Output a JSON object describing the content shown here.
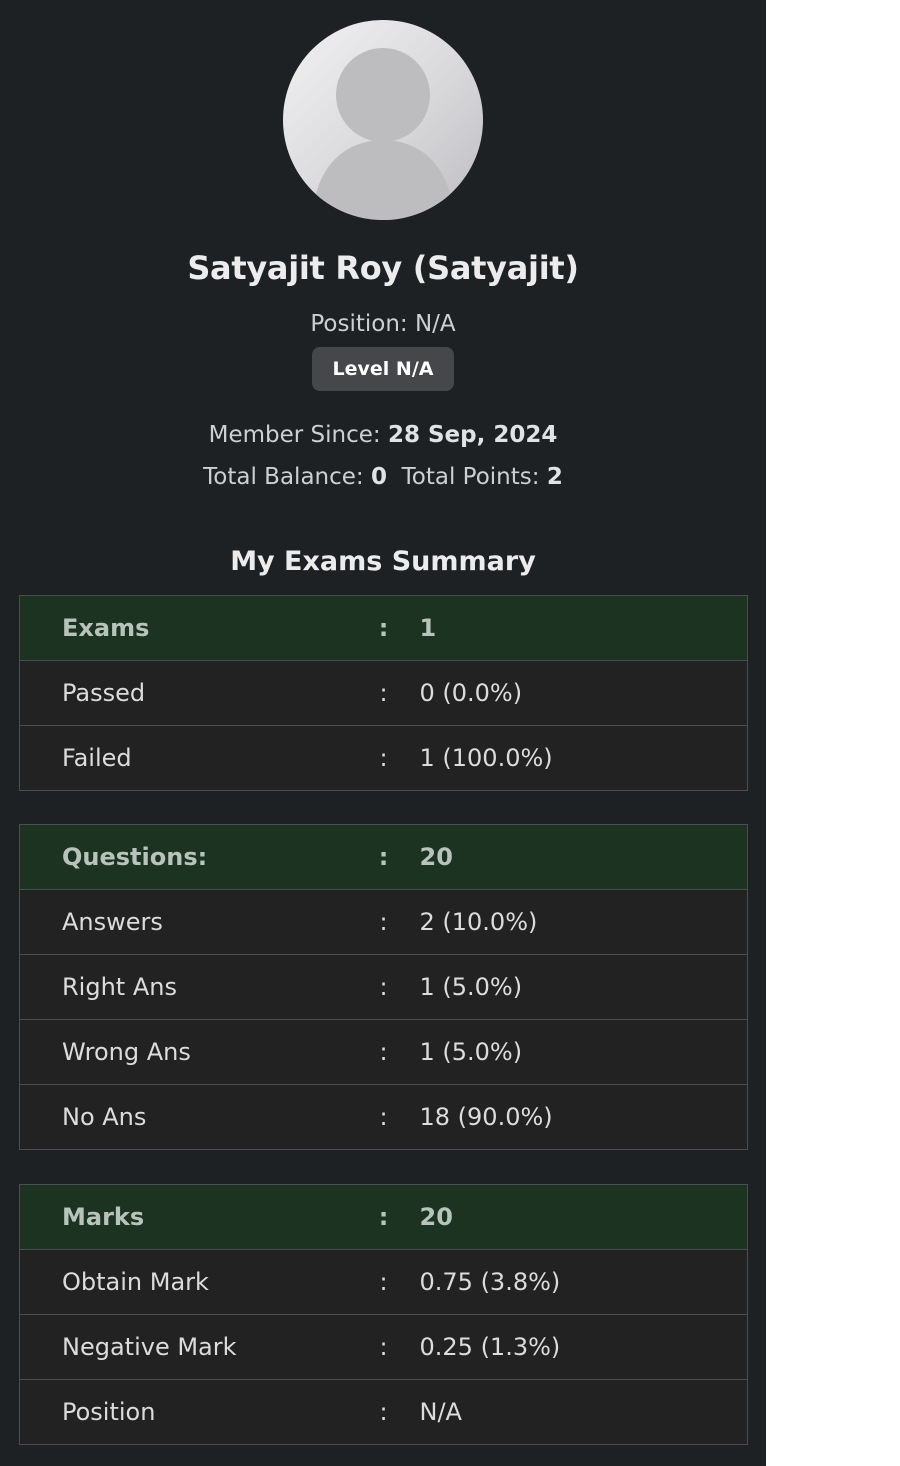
{
  "profile": {
    "name": "Satyajit Roy (Satyajit)",
    "position_line": "Position: N/A",
    "level_badge": "Level N/A",
    "member_since_label": "Member Since:",
    "member_since_value": "28 Sep, 2024",
    "total_balance_label": "Total Balance:",
    "total_balance_value": "0",
    "total_points_label": "Total Points:",
    "total_points_value": "2"
  },
  "summary": {
    "title": "My Exams Summary",
    "separator": ":",
    "exams_table": {
      "header": {
        "label": "Exams",
        "value": "1"
      },
      "rows": [
        {
          "label": "Passed",
          "value": "0 (0.0%)"
        },
        {
          "label": "Failed",
          "value": "1 (100.0%)"
        }
      ]
    },
    "questions_table": {
      "header": {
        "label": "Questions:",
        "value": "20"
      },
      "rows": [
        {
          "label": "Answers",
          "value": "2 (10.0%)"
        },
        {
          "label": "Right Ans",
          "value": "1 (5.0%)"
        },
        {
          "label": "Wrong Ans",
          "value": "1 (5.0%)"
        },
        {
          "label": "No Ans",
          "value": "18 (90.0%)"
        }
      ]
    },
    "marks_table": {
      "header": {
        "label": "Marks",
        "value": "20"
      },
      "rows": [
        {
          "label": "Obtain Mark",
          "value": "0.75 (3.8%)"
        },
        {
          "label": "Negative Mark",
          "value": "0.25 (1.3%)"
        },
        {
          "label": "Position",
          "value": "N/A"
        }
      ]
    }
  },
  "colors": {
    "panel_bg": "#1e2124",
    "header_row_bg": "#1b3320",
    "body_row_bg": "#222222",
    "badge_bg": "#45474b"
  },
  "icons": {
    "avatar": "default-user-avatar-icon"
  }
}
